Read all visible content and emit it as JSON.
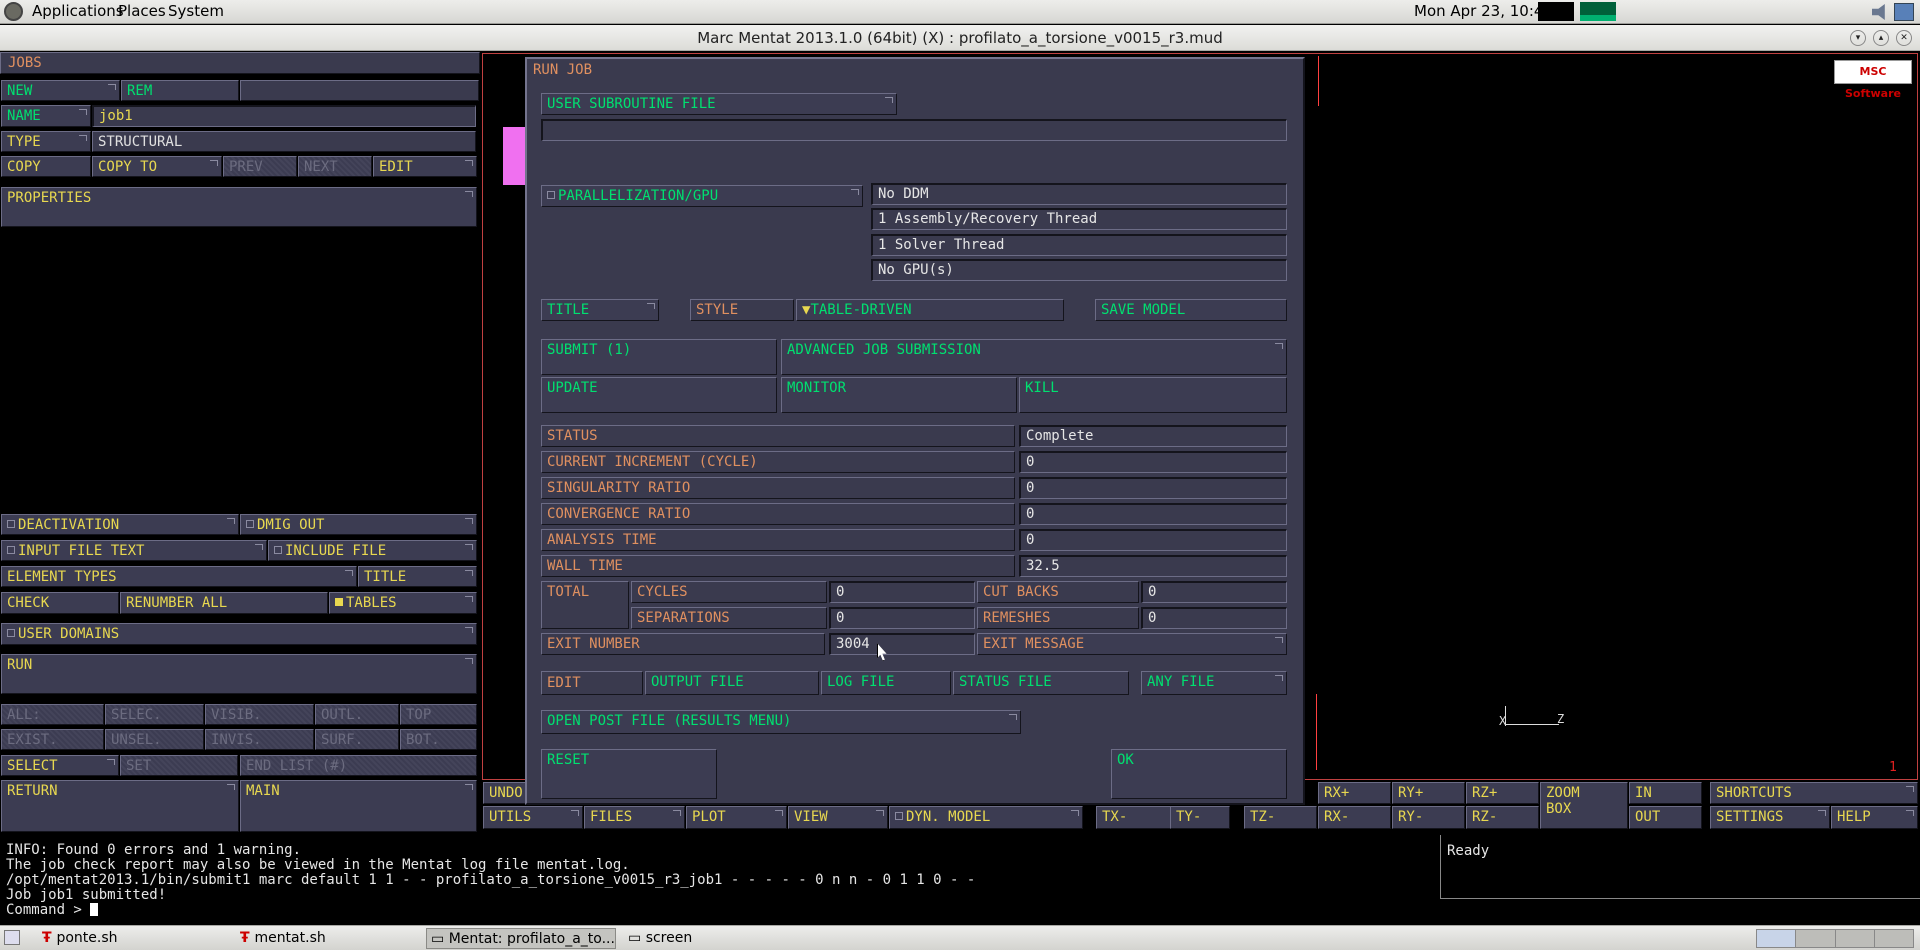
{
  "topbar": {
    "menus": [
      "Applications",
      "Places",
      "System"
    ],
    "clock": "Mon Apr 23, 10:42"
  },
  "window_title": "Marc Mentat 2013.1.0 (64bit) (X) : profilato_a_torsione_v0015_r3.mud",
  "left": {
    "header": "JOBS",
    "new": "NEW",
    "rem": "REM",
    "name_label": "NAME",
    "name_value": "job1",
    "type_label": "TYPE",
    "type_value": "STRUCTURAL",
    "copy": "COPY",
    "copy_to": "COPY TO",
    "prev": "PREV",
    "next": "NEXT",
    "edit": "EDIT",
    "properties": "PROPERTIES",
    "deactivation": "DEACTIVATION",
    "dmig_out": "DMIG OUT",
    "input_file_text": "INPUT FILE TEXT",
    "include_file": "INCLUDE FILE",
    "element_types": "ELEMENT TYPES",
    "title": "TITLE",
    "check": "CHECK",
    "renumber_all": "RENUMBER ALL",
    "tables": "TABLES",
    "user_domains": "USER DOMAINS",
    "run": "RUN",
    "sel_row1": [
      "ALL:",
      "SELEC.",
      "VISIB.",
      "OUTL.",
      "TOP"
    ],
    "sel_row2": [
      "EXIST.",
      "UNSEL.",
      "INVIS.",
      "SURF.",
      "BOT."
    ],
    "select": "SELECT",
    "set": "SET",
    "end_list": "END LIST (#)",
    "return": "RETURN",
    "main": "MAIN"
  },
  "dialog": {
    "title": "RUN JOB",
    "user_subroutine": "USER SUBROUTINE FILE",
    "user_subroutine_value": "",
    "parallel": "PARALLELIZATION/GPU",
    "parallel_values": [
      "No DDM",
      "1 Assembly/Recovery Thread",
      "1 Solver Thread",
      "No GPU(s)"
    ],
    "title_btn": "TITLE",
    "style_label": "STYLE",
    "style_value": "TABLE-DRIVEN",
    "save_model": "SAVE MODEL",
    "submit": "SUBMIT (1)",
    "advanced": "ADVANCED JOB SUBMISSION",
    "update": "UPDATE",
    "monitor": "MONITOR",
    "kill": "KILL",
    "stats": [
      {
        "label": "STATUS",
        "value": "Complete"
      },
      {
        "label": "CURRENT INCREMENT (CYCLE)",
        "value": "0"
      },
      {
        "label": "SINGULARITY RATIO",
        "value": "0"
      },
      {
        "label": "CONVERGENCE RATIO",
        "value": "0"
      },
      {
        "label": "ANALYSIS TIME",
        "value": "0"
      },
      {
        "label": "WALL TIME",
        "value": "32.5"
      }
    ],
    "total": "TOTAL",
    "cycles": "CYCLES",
    "cycles_value": "0",
    "cut_backs": "CUT BACKS",
    "cut_backs_value": "0",
    "separations": "SEPARATIONS",
    "separations_value": "0",
    "remeshes": "REMESHES",
    "remeshes_value": "0",
    "exit_number": "EXIT NUMBER",
    "exit_number_value": "3004",
    "exit_message": "EXIT MESSAGE",
    "edit": "EDIT",
    "output_file": "OUTPUT FILE",
    "log_file": "LOG FILE",
    "status_file": "STATUS FILE",
    "any_file": "ANY FILE",
    "open_post": "OPEN POST FILE (RESULTS MENU)",
    "reset": "RESET",
    "ok": "OK"
  },
  "viewport": {
    "logo": "MSC Software",
    "axis_x": "X",
    "axis_z": "Z",
    "number": "1"
  },
  "bottom_menu": {
    "undo": "UNDO",
    "utils": "UTILS",
    "files": "FILES",
    "plot": "PLOT",
    "view": "VIEW",
    "dyn_model": "DYN. MODEL",
    "tx": "TX-",
    "ty": "TY-",
    "tz": "TZ-",
    "rxp": "RX+",
    "ryp": "RY+",
    "rzp": "RZ+",
    "rxm": "RX-",
    "rym": "RY-",
    "rzm": "RZ-",
    "zoom": "ZOOM",
    "box": "BOX",
    "in": "IN",
    "out": "OUT",
    "shortcuts": "SHORTCUTS",
    "settings": "SETTINGS",
    "help": "HELP"
  },
  "console": {
    "lines": [
      "INFO: Found 0 errors and 1 warning.",
      "The job check report may also be viewed in the Mentat log file mentat.log.",
      "/opt/mentat2013.1/bin/submit1 marc default 1 1 - - profilato_a_torsione_v0015_r3_job1 - - - - - 0 n n - 0 1 1 0 - -",
      "Job job1 submitted!"
    ],
    "prompt": "Command >",
    "status": "Ready"
  },
  "taskbar": {
    "items": [
      "ponte.sh",
      "mentat.sh",
      "Mentat: profilato_a_to...",
      "screen"
    ]
  },
  "colors": {
    "panel": "#3a3a4e",
    "cyan": "#00d8d8",
    "yellow": "#e8d850",
    "orange": "#e09060",
    "green": "#00e070"
  }
}
